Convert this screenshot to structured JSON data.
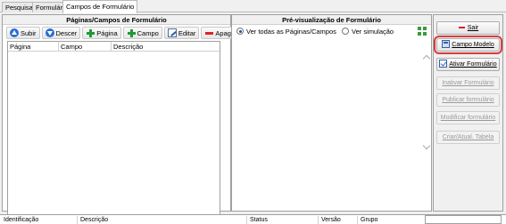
{
  "tabs": [
    "Pesquisa",
    "Formulário",
    "Campos de Formulário"
  ],
  "left_panel": {
    "title": "Páginas/Campos de Formulário",
    "toolbar": {
      "subir": "Subir",
      "descer": "Descer",
      "pagina": "Página",
      "campo": "Campo",
      "editar": "Editar",
      "apagar": "Apagar"
    },
    "columns": [
      "Página",
      "Campo",
      "Descrição"
    ]
  },
  "preview_panel": {
    "title": "Pré-visualização de Formulário",
    "radio_all": "Ver todas as Páginas/Campos",
    "radio_sim": "Ver simulação",
    "selected": "radio_all"
  },
  "actions": {
    "sair": "Sair",
    "campo_modelo": "Campo Modelo",
    "ativar": "Ativar Formulário",
    "inativar": "Inativar Formulário",
    "publicar": "Publicar formulário",
    "modificar": "Modificar formulário",
    "criar": "Criar/Atual. Tabela"
  },
  "bottom_columns": [
    "Identificação",
    "Descrição",
    "Status",
    "Versão",
    "Grupo"
  ],
  "colors": {
    "accent": "#2a6fd6",
    "highlight": "#d63c3c"
  }
}
